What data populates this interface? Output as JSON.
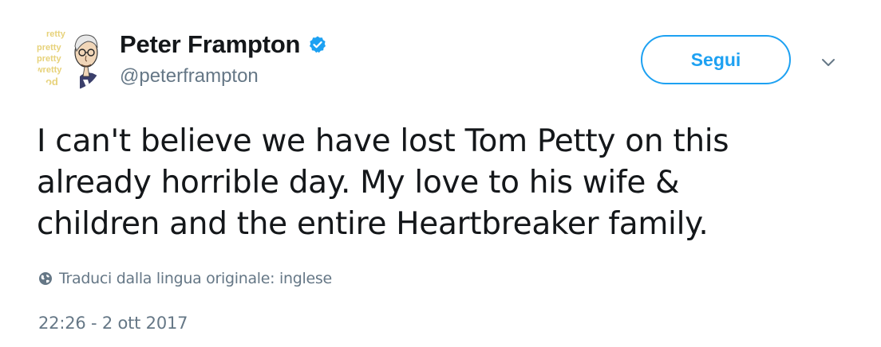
{
  "author": {
    "display_name": "Peter Frampton",
    "handle": "@peterframpton",
    "verified": true,
    "avatar_text": [
      "retty",
      "pretty",
      "pretty",
      "wretty",
      "ood"
    ]
  },
  "actions": {
    "follow_label": "Segui",
    "more_icon": "chevron-down-icon"
  },
  "tweet": {
    "text_lines": [
      "I can't believe we have lost Tom Petty on this",
      "already horrible day. My love to his wife &",
      "children and the entire Heartbreaker family."
    ]
  },
  "translate": {
    "icon": "globe-icon",
    "label": "Traduci dalla lingua originale: inglese"
  },
  "timestamp": "22:26 - 2 ott 2017",
  "colors": {
    "accent": "#1da1f2",
    "text_primary": "#14171a",
    "text_secondary": "#657786",
    "avatar_text": "#e7d27a"
  }
}
